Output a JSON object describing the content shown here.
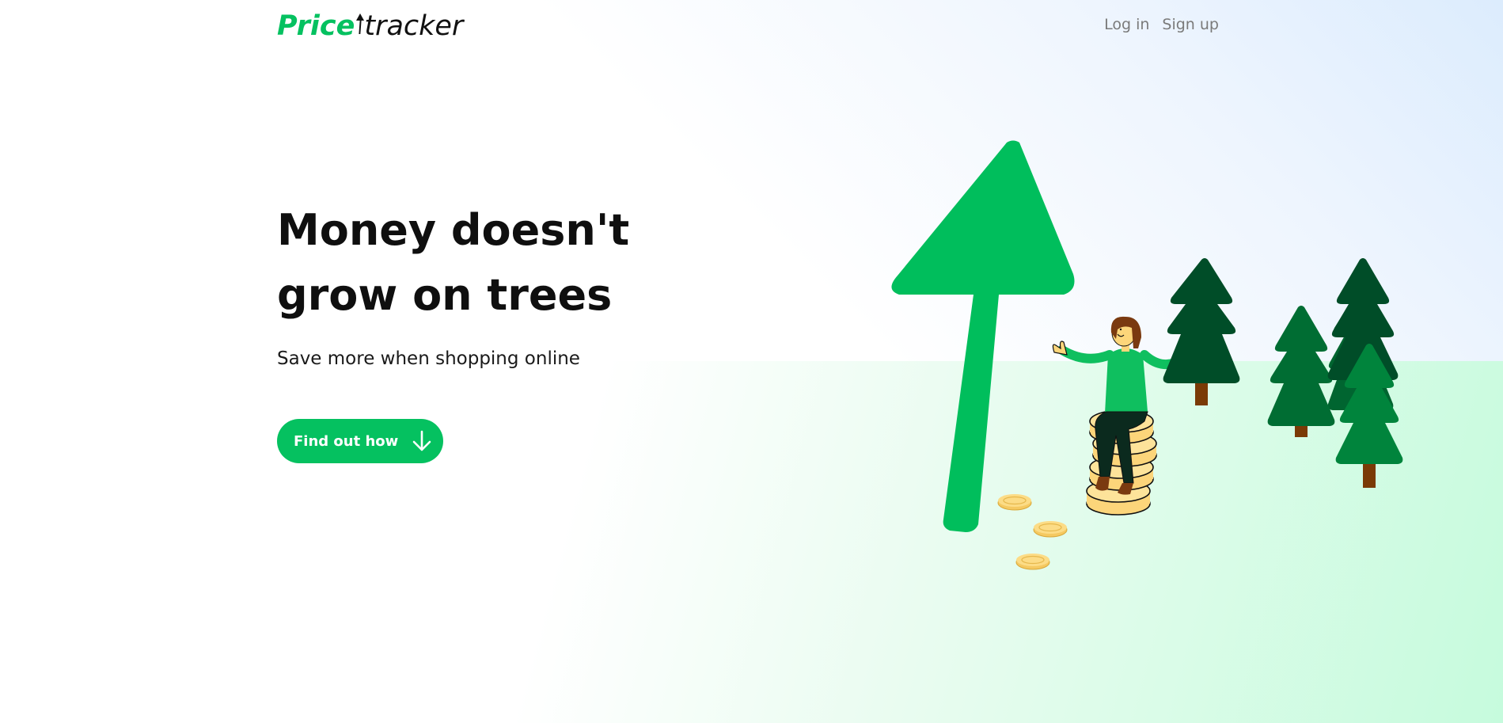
{
  "brand": {
    "logo_part1": "Price",
    "logo_part2": "tracker",
    "accent_color": "#05c160"
  },
  "nav": {
    "login_label": "Log in",
    "signup_label": "Sign up"
  },
  "hero": {
    "headline": "Money doesn't grow on trees",
    "subheadline": "Save more when shopping online",
    "cta_label": "Find out how",
    "cta_icon": "arrow-down-icon"
  },
  "illustration": {
    "elements": [
      "growth-arrow-icon",
      "person-on-coins",
      "coin-stack",
      "scattered-coins",
      "pine-trees"
    ]
  }
}
